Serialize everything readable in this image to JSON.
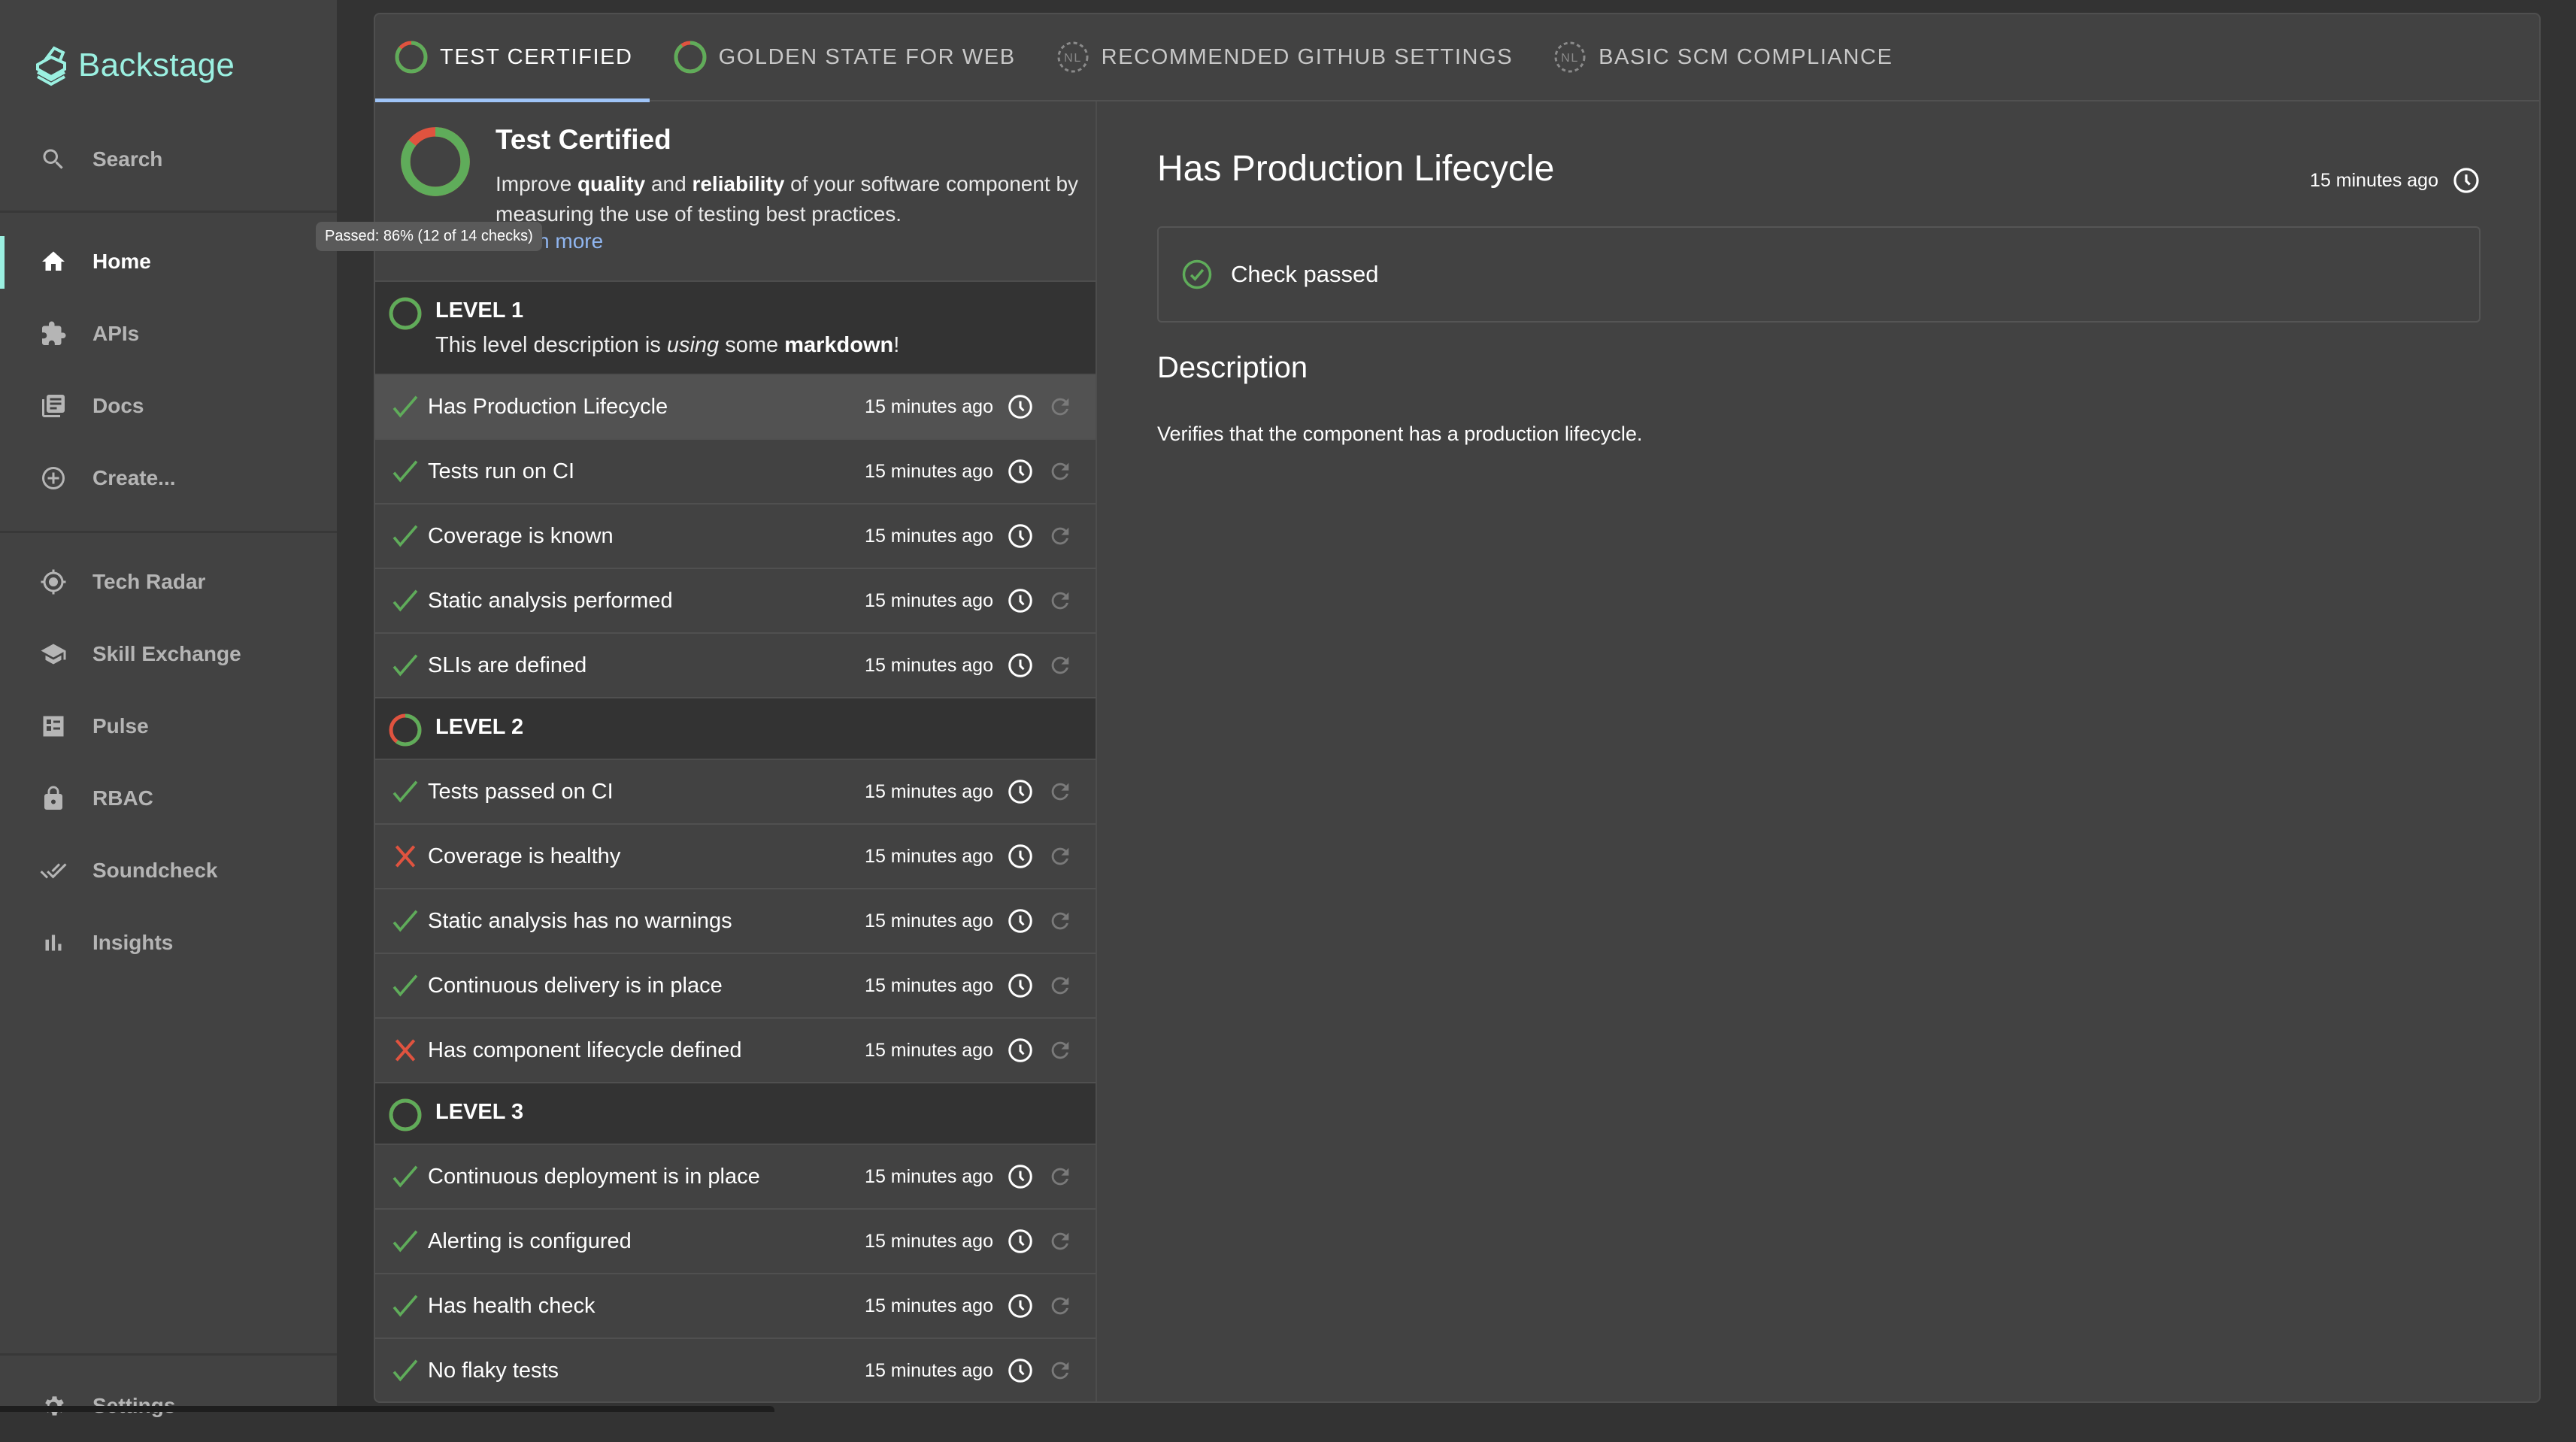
{
  "app": {
    "name": "Backstage",
    "brand_color": "#9BF0E1"
  },
  "sidebar": {
    "search_label": "Search",
    "items": [
      {
        "label": "Home",
        "icon": "home-icon",
        "active": true
      },
      {
        "label": "APIs",
        "icon": "puzzle-icon"
      },
      {
        "label": "Docs",
        "icon": "library-books-icon"
      },
      {
        "label": "Create...",
        "icon": "add-circle-icon"
      },
      {
        "label": "Tech Radar",
        "icon": "radar-icon"
      },
      {
        "label": "Skill Exchange",
        "icon": "school-icon"
      },
      {
        "label": "Pulse",
        "icon": "dashboard-icon"
      },
      {
        "label": "RBAC",
        "icon": "lock-icon"
      },
      {
        "label": "Soundcheck",
        "icon": "double-check-icon"
      },
      {
        "label": "Insights",
        "icon": "bar-chart-icon"
      }
    ],
    "settings_label": "Settings"
  },
  "tabs": [
    {
      "label": "TEST CERTIFIED",
      "active": true,
      "badge": "progress",
      "passed_fraction": 0.86
    },
    {
      "label": "GOLDEN STATE FOR WEB",
      "badge": "progress",
      "passed_fraction": 0.9
    },
    {
      "label": "RECOMMENDED GITHUB SETTINGS",
      "badge": "NL"
    },
    {
      "label": "BASIC SCM COMPLIANCE",
      "badge": "NL"
    }
  ],
  "summary": {
    "title": "Test Certified",
    "desc_parts": [
      "Improve ",
      "quality",
      " and ",
      "reliability",
      " of your software component by measuring the use of testing best practices."
    ],
    "learn_more": "Learn more",
    "tooltip": "Passed: 86% (12 of 14 checks)",
    "passed_fraction": 0.857
  },
  "levels": [
    {
      "name": "LEVEL 1",
      "desc_parts": [
        "This level description is ",
        "using",
        " some ",
        "markdown",
        "!"
      ],
      "passed_fraction": 1.0,
      "checks": [
        {
          "name": "Has Production Lifecycle",
          "status": "pass",
          "time": "15 minutes ago",
          "selected": true
        },
        {
          "name": "Tests run on CI",
          "status": "pass",
          "time": "15 minutes ago"
        },
        {
          "name": "Coverage is known",
          "status": "pass",
          "time": "15 minutes ago"
        },
        {
          "name": "Static analysis performed",
          "status": "pass",
          "time": "15 minutes ago"
        },
        {
          "name": "SLIs are defined",
          "status": "pass",
          "time": "15 minutes ago"
        }
      ]
    },
    {
      "name": "LEVEL 2",
      "passed_fraction": 0.6,
      "checks": [
        {
          "name": "Tests passed on CI",
          "status": "pass",
          "time": "15 minutes ago"
        },
        {
          "name": "Coverage is healthy",
          "status": "fail",
          "time": "15 minutes ago"
        },
        {
          "name": "Static analysis has no warnings",
          "status": "pass",
          "time": "15 minutes ago"
        },
        {
          "name": "Continuous delivery is in place",
          "status": "pass",
          "time": "15 minutes ago"
        },
        {
          "name": "Has component lifecycle defined",
          "status": "fail",
          "time": "15 minutes ago"
        }
      ]
    },
    {
      "name": "LEVEL 3",
      "passed_fraction": 1.0,
      "checks": [
        {
          "name": "Continuous deployment is in place",
          "status": "pass",
          "time": "15 minutes ago"
        },
        {
          "name": "Alerting is configured",
          "status": "pass",
          "time": "15 minutes ago"
        },
        {
          "name": "Has health check",
          "status": "pass",
          "time": "15 minutes ago"
        },
        {
          "name": "No flaky tests",
          "status": "pass",
          "time": "15 minutes ago"
        }
      ]
    }
  ],
  "detail": {
    "title": "Has Production Lifecycle",
    "time": "15 minutes ago",
    "result": "Check passed",
    "description_heading": "Description",
    "description": "Verifies that the component has a production lifecycle."
  },
  "colors": {
    "pass": "#5fac5a",
    "fail": "#e0533f",
    "accent": "#9fc4f7"
  }
}
